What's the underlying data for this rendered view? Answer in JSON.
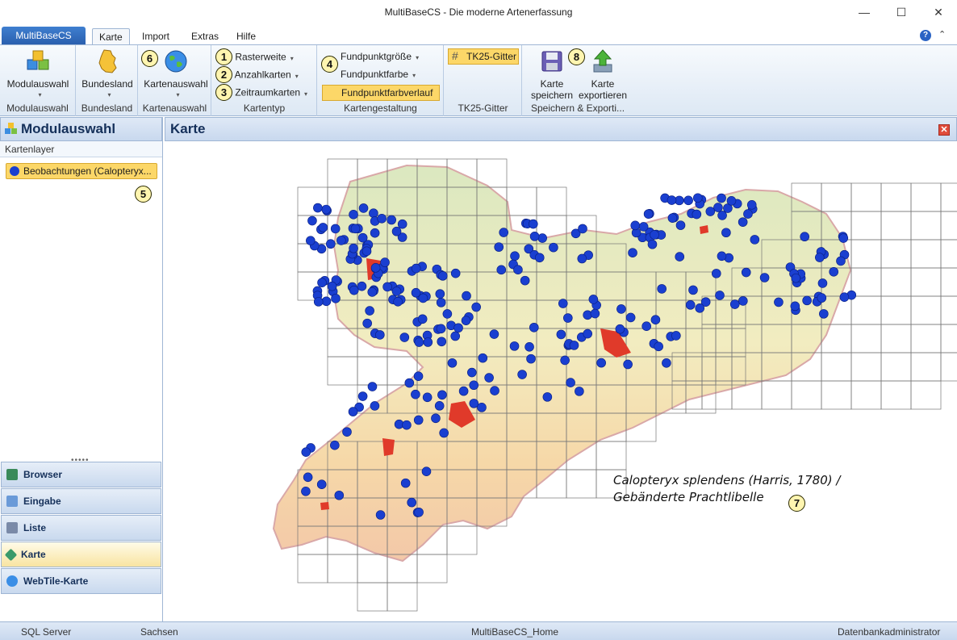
{
  "window": {
    "title": "MultiBaseCS - Die moderne Artenerfassung"
  },
  "menu": {
    "app_button": "MultiBaseCS",
    "tabs": [
      "Karte",
      "Import",
      "Extras",
      "Hilfe"
    ],
    "active_tab": "Karte"
  },
  "ribbon": {
    "groups": {
      "modulauswahl": {
        "button": "Modulauswahl",
        "label": "Modulauswahl"
      },
      "bundesland": {
        "button": "Bundesland",
        "label": "Bundesland"
      },
      "kartenauswahl": {
        "button": "Kartenauswahl",
        "label": "Kartenauswahl",
        "badge": "6"
      },
      "kartentyp": {
        "label": "Kartentyp",
        "items": [
          {
            "badge": "1",
            "label": "Rasterweite"
          },
          {
            "badge": "2",
            "label": "Anzahlkarten"
          },
          {
            "badge": "3",
            "label": "Zeitraumkarten"
          }
        ]
      },
      "kartengestaltung": {
        "label": "Kartengestaltung",
        "badge": "4",
        "items": [
          "Fundpunktgröße",
          "Fundpunktfarbe",
          "Fundpunktfarbverlauf"
        ]
      },
      "tk25": {
        "button": "TK25-Gitter",
        "label": "TK25-Gitter"
      },
      "speichern": {
        "label": "Speichern & Exporti...",
        "badge": "8",
        "save_line1": "Karte",
        "save_line2": "speichern",
        "export_line1": "Karte",
        "export_line2": "exportieren"
      }
    }
  },
  "left_pane": {
    "title": "Modulauswahl",
    "subtitle": "Kartenlayer",
    "layer": "Beobachtungen  (Calopteryx...",
    "badge": "5",
    "nav": [
      "Browser",
      "Eingabe",
      "Liste",
      "Karte",
      "WebTile-Karte"
    ],
    "active_nav": "Karte"
  },
  "main": {
    "title": "Karte",
    "caption_line1": "Calopteryx splendens (Harris, 1780) /",
    "caption_line2": "Gebänderte Prachtlibelle",
    "badge": "7"
  },
  "status": {
    "server": "SQL Server",
    "region": "Sachsen",
    "database": "MultiBaseCS_Home",
    "user": "Datenbankadministrator"
  },
  "colors": {
    "accent": "#2a5fae",
    "highlight": "#fcd768",
    "point": "#1a3fd0",
    "city": "#e03a2a"
  }
}
